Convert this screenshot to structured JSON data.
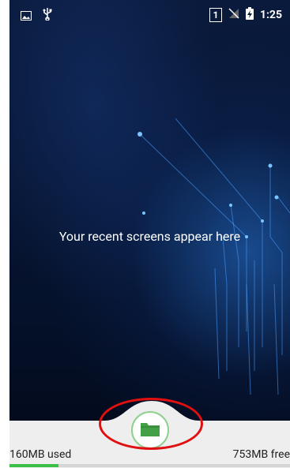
{
  "status_bar": {
    "sim_slot": "1",
    "time": "1:25",
    "icons": [
      "image-icon",
      "usb-icon",
      "no-signal-icon",
      "battery-charging-icon"
    ]
  },
  "recents": {
    "empty_message": "Your recent screens appear here"
  },
  "memory": {
    "used_label": "160MB used",
    "free_label": "753MB free",
    "used_fraction": 0.175,
    "bar_color": "#3bbf47"
  },
  "folder_button": {
    "icon": "folder-icon",
    "color": "#43a047"
  }
}
